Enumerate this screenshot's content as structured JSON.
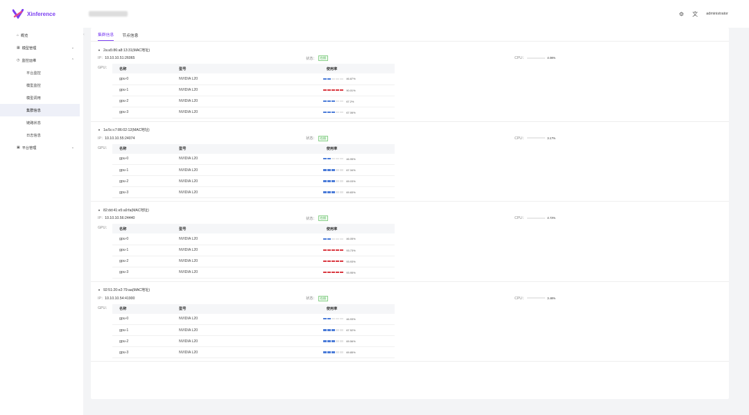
{
  "app": {
    "name": "Xinference",
    "brand_color": "#7b3ff2"
  },
  "header": {
    "user": "administrator",
    "settings_icon": "gear-icon",
    "lang_icon": "translate-icon"
  },
  "sidebar": {
    "items": [
      {
        "label": "概览",
        "icon": "home-icon"
      },
      {
        "label": "模型管理",
        "icon": "grid-icon",
        "chevron": "down"
      },
      {
        "label": "监控运维",
        "icon": "monitor-icon",
        "chevron": "up"
      },
      {
        "label": "平台监控"
      },
      {
        "label": "模型监控"
      },
      {
        "label": "模型调用"
      },
      {
        "label": "集群信息",
        "active": true
      },
      {
        "label": "链路状态"
      },
      {
        "label": "日志信息"
      },
      {
        "label": "平台管理",
        "icon": "settings-icon",
        "chevron": "down"
      }
    ]
  },
  "tabs": [
    {
      "label": "集群信息",
      "active": true
    },
    {
      "label": "节点信息"
    }
  ],
  "labels": {
    "ip": "IP：",
    "status": "状态：",
    "cpu": "CPU：",
    "gpu": "GPU：",
    "col_name": "名称",
    "col_model": "型号",
    "col_usage": "使用率"
  },
  "status_colors": {
    "normal": "#4a7bd8",
    "high": "#d9363e"
  },
  "nodes": [
    {
      "mac": "2a:a5:86:a8:13:31(MAC地址)",
      "ip": "10.10.10.51:26065",
      "status": "在线",
      "cpu": "4.06%",
      "gpus": [
        {
          "name": "gpu-0",
          "model": "NVIDIA L20",
          "usage": "46.87%",
          "pct": 46.87,
          "level": "normal"
        },
        {
          "name": "gpu-1",
          "model": "NVIDIA L20",
          "usage": "90.01%",
          "pct": 90.01,
          "level": "high"
        },
        {
          "name": "gpu-2",
          "model": "NVIDIA L20",
          "usage": "67.2%",
          "pct": 67.2,
          "level": "normal"
        },
        {
          "name": "gpu-3",
          "model": "NVIDIA L20",
          "usage": "67.06%",
          "pct": 67.06,
          "level": "normal"
        }
      ]
    },
    {
      "mac": "1a:5c:c7:86:02:12(MAC地址)",
      "ip": "10.10.10.55:24074",
      "status": "在线",
      "cpu": "3.17%",
      "gpus": [
        {
          "name": "gpu-0",
          "model": "NVIDIA L20",
          "usage": "46.95%",
          "pct": 46.95,
          "level": "normal"
        },
        {
          "name": "gpu-1",
          "model": "NVIDIA L20",
          "usage": "67.34%",
          "pct": 67.34,
          "level": "normal"
        },
        {
          "name": "gpu-2",
          "model": "NVIDIA L20",
          "usage": "69.03%",
          "pct": 69.03,
          "level": "normal"
        },
        {
          "name": "gpu-3",
          "model": "NVIDIA L20",
          "usage": "69.83%",
          "pct": 69.83,
          "level": "normal"
        }
      ]
    },
    {
      "mac": "82:dd:41:e5:a9:fa(MAC地址)",
      "ip": "10.10.10.56:24440",
      "status": "在线",
      "cpu": "4.72%",
      "gpus": [
        {
          "name": "gpu-0",
          "model": "NVIDIA L20",
          "usage": "46.05%",
          "pct": 46.05,
          "level": "normal"
        },
        {
          "name": "gpu-1",
          "model": "NVIDIA L20",
          "usage": "93.73%",
          "pct": 93.73,
          "level": "high"
        },
        {
          "name": "gpu-2",
          "model": "NVIDIA L20",
          "usage": "93.93%",
          "pct": 93.93,
          "level": "high"
        },
        {
          "name": "gpu-3",
          "model": "NVIDIA L20",
          "usage": "93.95%",
          "pct": 93.95,
          "level": "high"
        }
      ]
    },
    {
      "mac": "92:51:20:e2:79:aa(MAC地址)",
      "ip": "10.10.10.54:41900",
      "status": "在线",
      "cpu": "3.46%",
      "gpus": [
        {
          "name": "gpu-0",
          "model": "NVIDIA L20",
          "usage": "46.93%",
          "pct": 46.93,
          "level": "normal"
        },
        {
          "name": "gpu-1",
          "model": "NVIDIA L20",
          "usage": "67.52%",
          "pct": 67.52,
          "level": "normal"
        },
        {
          "name": "gpu-2",
          "model": "NVIDIA L20",
          "usage": "69.56%",
          "pct": 69.56,
          "level": "normal"
        },
        {
          "name": "gpu-3",
          "model": "NVIDIA L20",
          "usage": "69.85%",
          "pct": 69.85,
          "level": "normal"
        }
      ]
    }
  ]
}
